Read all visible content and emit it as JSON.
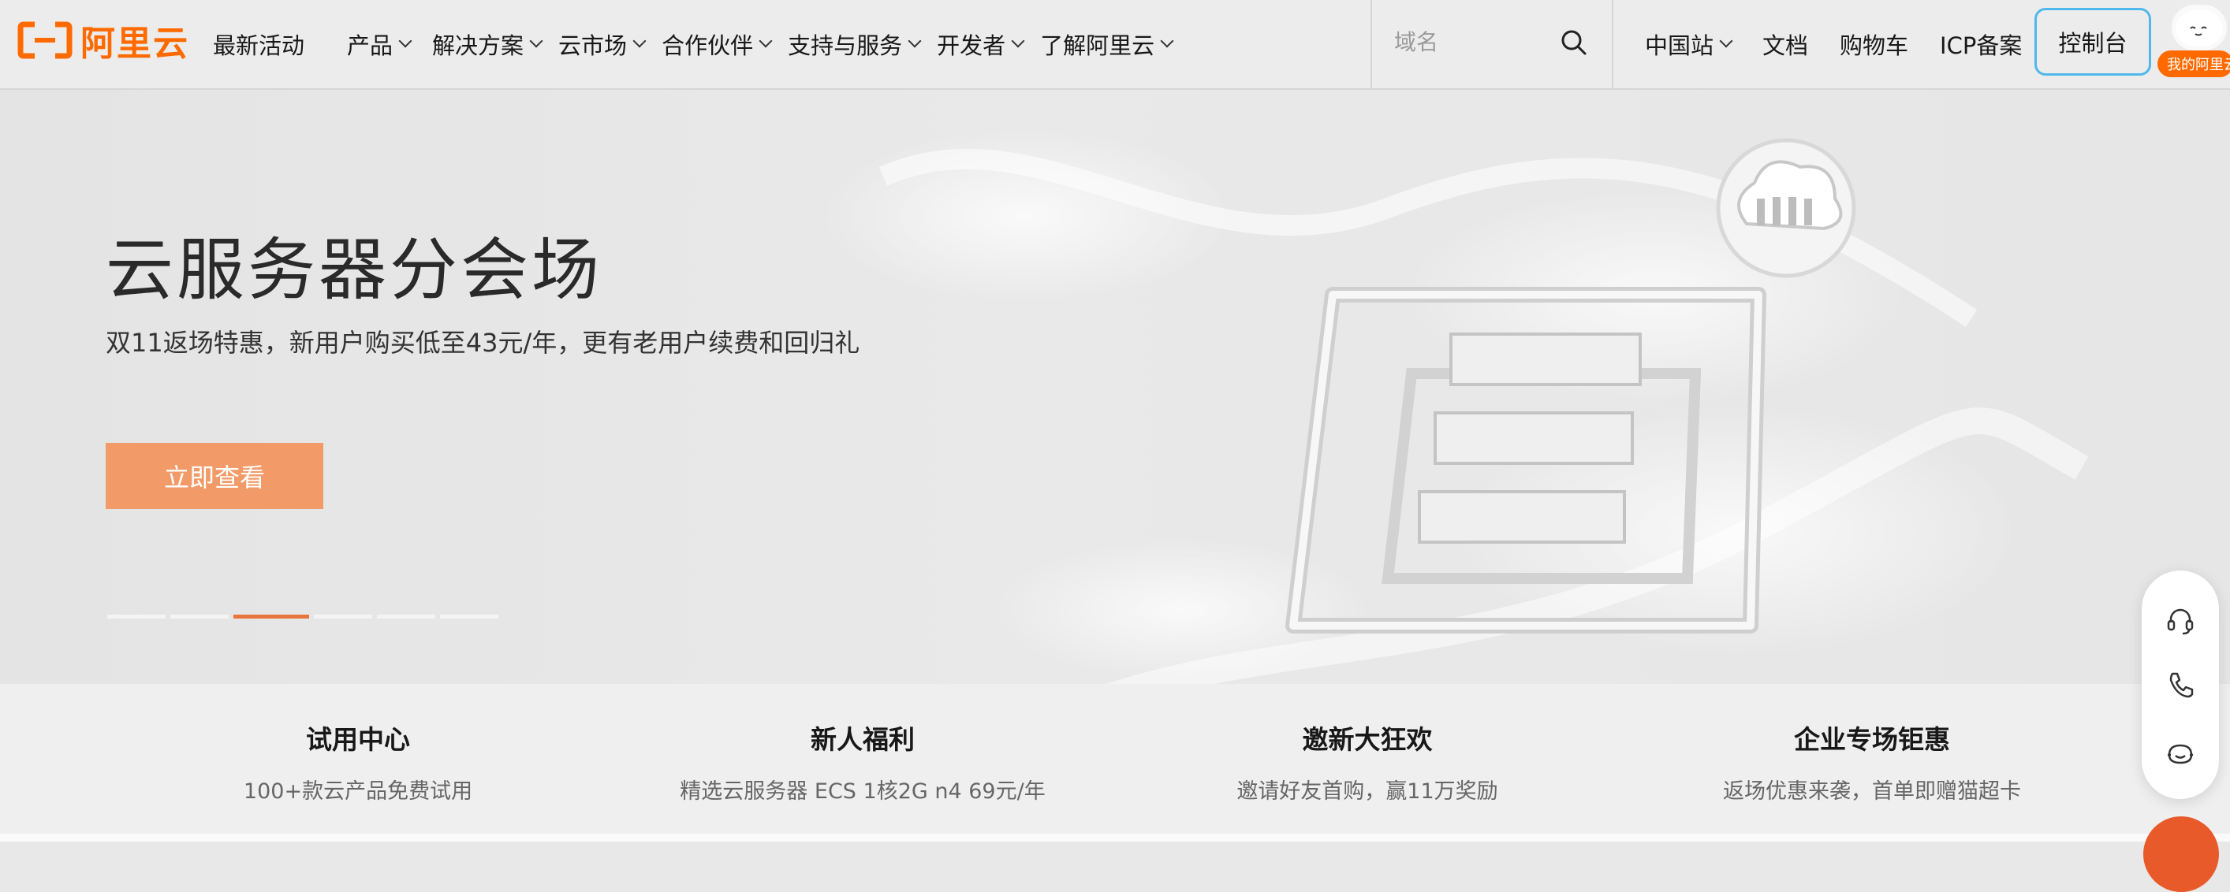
{
  "header": {
    "logo_text": "阿里云",
    "nav": [
      {
        "label": "最新活动",
        "dropdown": false
      },
      {
        "label": "产品",
        "dropdown": true
      },
      {
        "label": "解决方案",
        "dropdown": true
      },
      {
        "label": "云市场",
        "dropdown": true
      },
      {
        "label": "合作伙伴",
        "dropdown": true
      },
      {
        "label": "支持与服务",
        "dropdown": true
      },
      {
        "label": "开发者",
        "dropdown": true
      },
      {
        "label": "了解阿里云",
        "dropdown": true
      }
    ],
    "search_placeholder": "域名",
    "right_nav": [
      {
        "label": "中国站",
        "dropdown": true
      },
      {
        "label": "文档"
      },
      {
        "label": "购物车"
      },
      {
        "label": "ICP备案"
      }
    ],
    "console_label": "控制台",
    "my_aliyun_label": "我的阿里云"
  },
  "hero": {
    "title": "云服务器分会场",
    "subtitle": "双11返场特惠，新用户购买低至43元/年，更有老用户续费和回归礼",
    "button_label": "立即查看",
    "slides_count": 6,
    "active_slide": 3
  },
  "promo_cards": [
    {
      "title": "试用中心",
      "desc": "100+款云产品免费试用"
    },
    {
      "title": "新人福利",
      "desc": "精选云服务器 ECS 1核2G n4 69元/年"
    },
    {
      "title": "邀新大狂欢",
      "desc": "邀请好友首购，赢11万奖励"
    },
    {
      "title": "企业专场钜惠",
      "desc": "返场优惠来袭，首单即赠猫超卡"
    }
  ],
  "floating_tools": [
    "headset-icon",
    "phone-icon",
    "chat-bot-icon"
  ],
  "colors": {
    "brand": "#ff6a00",
    "hero_button": "#f39b68",
    "active_dot": "#e8753e",
    "console_border": "#4fb8ec"
  }
}
